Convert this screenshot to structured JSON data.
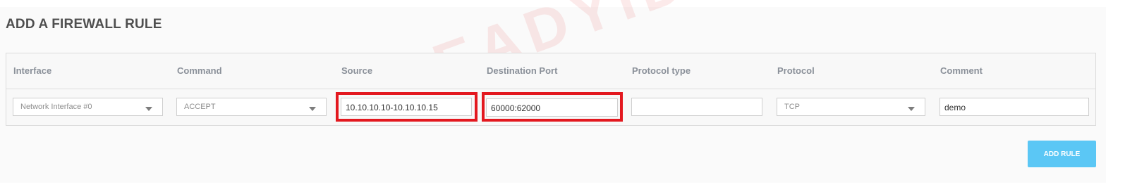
{
  "page": {
    "title": "ADD A FIREWALL RULE"
  },
  "watermark": "READYIDC",
  "table": {
    "headers": {
      "interface": "Interface",
      "command": "Command",
      "source": "Source",
      "destination_port": "Destination Port",
      "protocol_type": "Protocol type",
      "protocol": "Protocol",
      "comment": "Comment"
    },
    "row": {
      "interface": "Network Interface #0",
      "command": "ACCEPT",
      "source": "10.10.10.10-10.10.10.15",
      "destination_port": "60000:62000",
      "protocol_type": "",
      "protocol": "TCP",
      "comment": "demo"
    }
  },
  "actions": {
    "add_rule": "ADD RULE"
  },
  "colors": {
    "highlight": "#e3181f",
    "button": "#5bc7f5",
    "header_text": "#8a9099"
  }
}
